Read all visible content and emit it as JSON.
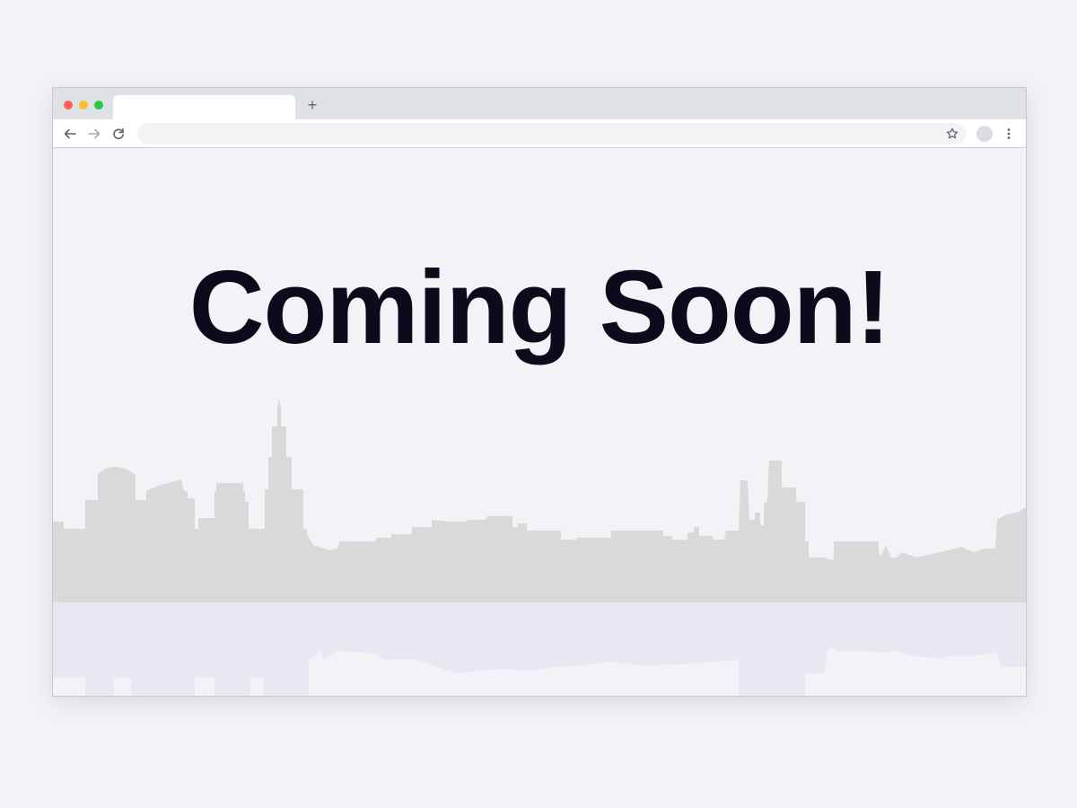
{
  "browser": {
    "tab_title": "",
    "new_tab_symbol": "+",
    "address": "",
    "icons": {
      "back": "back-arrow-icon",
      "forward": "forward-arrow-icon",
      "reload": "reload-icon",
      "bookmark": "star-icon",
      "profile": "profile-avatar-icon",
      "menu": "kebab-menu-icon"
    },
    "traffic_lights": [
      "#ff5f57",
      "#febc2e",
      "#28c840"
    ]
  },
  "page": {
    "headline": "Coming Soon!",
    "headline_color": "#0b0b1c",
    "background_color": "#f3f2f7",
    "skyline_color": "#d9d9d9",
    "reflection_color": "#e9e7f1"
  }
}
